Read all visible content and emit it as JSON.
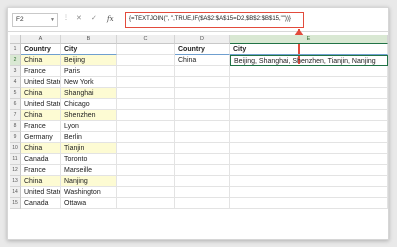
{
  "formula_bar": {
    "name_box": "F2",
    "cancel_icon": "✕",
    "enter_icon": "✓",
    "fx_label": "fx",
    "formula": "{=TEXTJOIN(\", \",TRUE,IF($A$2:$A$15=D2,$B$2:$B$15,\"\"))}"
  },
  "columns": [
    "A",
    "B",
    "C",
    "D",
    "E"
  ],
  "table": {
    "headers": [
      "Country",
      "City"
    ],
    "rows": [
      {
        "num": "2",
        "country": "China",
        "city": "Beijing",
        "hl": true
      },
      {
        "num": "3",
        "country": "France",
        "city": "Paris",
        "hl": false
      },
      {
        "num": "4",
        "country": "United States",
        "city": "New York",
        "hl": false
      },
      {
        "num": "5",
        "country": "China",
        "city": "Shanghai",
        "hl": true
      },
      {
        "num": "6",
        "country": "United States",
        "city": "Chicago",
        "hl": false
      },
      {
        "num": "7",
        "country": "China",
        "city": "Shenzhen",
        "hl": true
      },
      {
        "num": "8",
        "country": "France",
        "city": "Lyon",
        "hl": false
      },
      {
        "num": "9",
        "country": "Germany",
        "city": "Berlin",
        "hl": false
      },
      {
        "num": "10",
        "country": "China",
        "city": "Tianjin",
        "hl": true
      },
      {
        "num": "11",
        "country": "Canada",
        "city": "Toronto",
        "hl": false
      },
      {
        "num": "12",
        "country": "France",
        "city": "Marseille",
        "hl": false
      },
      {
        "num": "13",
        "country": "China",
        "city": "Nanjing",
        "hl": true
      },
      {
        "num": "14",
        "country": "United States",
        "city": "Washington",
        "hl": false
      },
      {
        "num": "15",
        "country": "Canada",
        "city": "Ottawa",
        "hl": false
      }
    ]
  },
  "row1_num": "1",
  "lookup": {
    "header_country": "Country",
    "header_city": "City",
    "country": "China",
    "result": "Beijing, Shanghai, Shenzhen, Tianjin, Nanjing"
  },
  "colors": {
    "highlight": "#fdfbd3",
    "callout": "#e24b3c",
    "selection": "#217346"
  }
}
